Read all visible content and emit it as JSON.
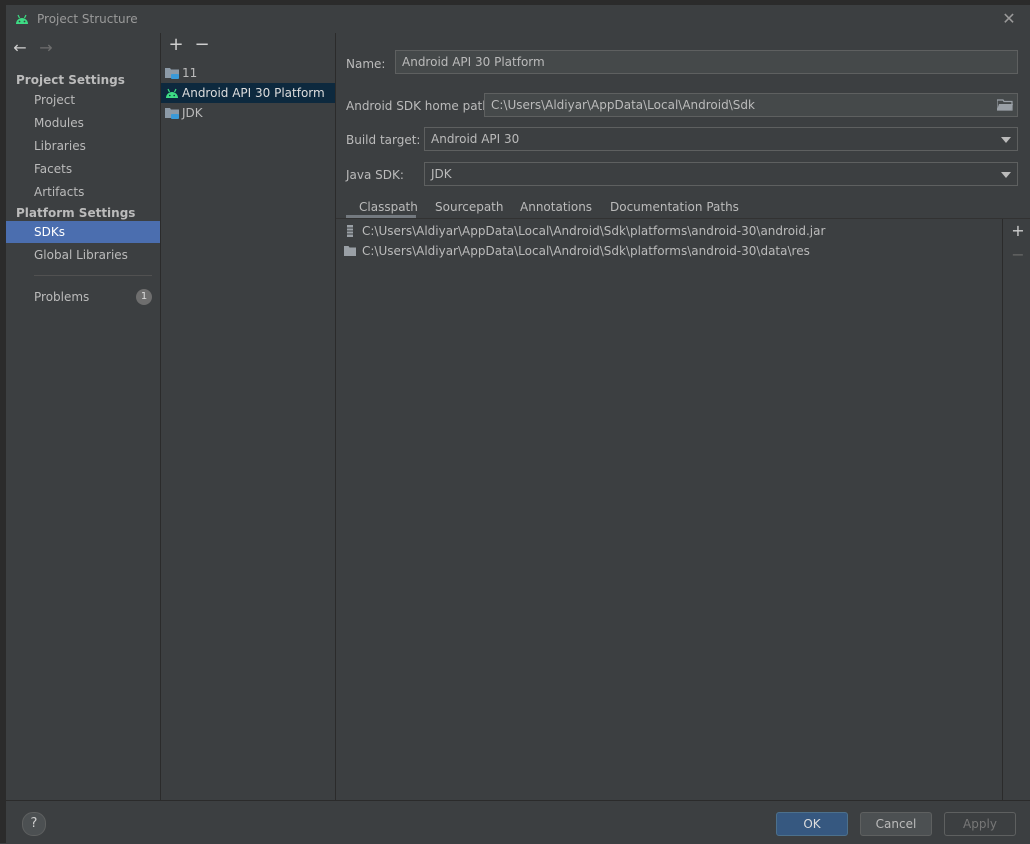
{
  "window": {
    "title": "Project Structure",
    "close_symbol": "✕"
  },
  "nav": {
    "back_symbol": "←",
    "forward_symbol": "→",
    "project_settings_label": "Project Settings",
    "platform_settings_label": "Platform Settings",
    "project_settings_items": [
      {
        "label": "Project"
      },
      {
        "label": "Modules"
      },
      {
        "label": "Libraries"
      },
      {
        "label": "Facets"
      },
      {
        "label": "Artifacts"
      }
    ],
    "platform_settings_items": [
      {
        "label": "SDKs",
        "selected": true
      },
      {
        "label": "Global Libraries"
      }
    ],
    "problems": {
      "label": "Problems",
      "count": "1"
    }
  },
  "sdk_list": {
    "add_symbol": "+",
    "remove_symbol": "−",
    "items": [
      {
        "label": "11",
        "icon": "folder-jdk-icon"
      },
      {
        "label": "Android API 30 Platform",
        "icon": "android-icon",
        "selected": true
      },
      {
        "label": "JDK",
        "icon": "folder-jdk-icon"
      }
    ]
  },
  "details": {
    "name_label": "Name:",
    "name_value": "Android API 30 Platform",
    "home_path_label": "Android SDK home path:",
    "home_path_value": "C:\\Users\\Aldiyar\\AppData\\Local\\Android\\Sdk",
    "build_target_label": "Build target:",
    "build_target_value": "Android API 30",
    "java_sdk_label": "Java SDK:",
    "java_sdk_value": "JDK",
    "tabs": [
      {
        "label": "Classpath",
        "active": true
      },
      {
        "label": "Sourcepath"
      },
      {
        "label": "Annotations"
      },
      {
        "label": "Documentation Paths"
      }
    ],
    "classpath_items": [
      {
        "path": "C:\\Users\\Aldiyar\\AppData\\Local\\Android\\Sdk\\platforms\\android-30\\android.jar",
        "icon": "jar-icon"
      },
      {
        "path": "C:\\Users\\Aldiyar\\AppData\\Local\\Android\\Sdk\\platforms\\android-30\\data\\res",
        "icon": "folder-icon"
      }
    ],
    "add_symbol": "+",
    "remove_symbol": "−"
  },
  "footer": {
    "help_label": "?",
    "ok_label": "OK",
    "cancel_label": "Cancel",
    "apply_label": "Apply"
  },
  "colors": {
    "background": "#3c3f41",
    "selection": "#4b6eaf",
    "list_selection": "#0d293e",
    "android_green": "#3ddc84",
    "primary_button": "#365880"
  }
}
